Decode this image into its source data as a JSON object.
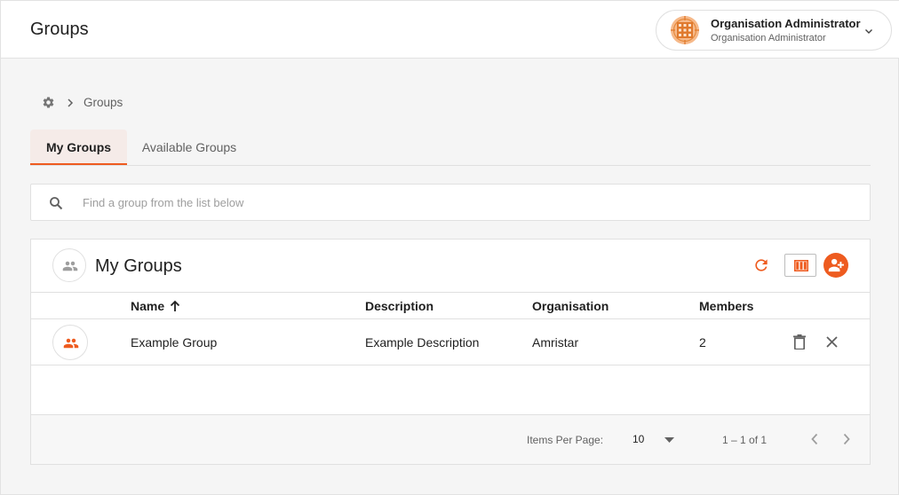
{
  "header": {
    "title": "Groups",
    "user": {
      "name": "Organisation Administrator",
      "role": "Organisation Administrator"
    }
  },
  "breadcrumb": {
    "current": "Groups"
  },
  "tabs": [
    {
      "label": "My Groups",
      "active": true
    },
    {
      "label": "Available Groups",
      "active": false
    }
  ],
  "search": {
    "value": "",
    "placeholder": "Find a group from the list below"
  },
  "card": {
    "title": "My Groups",
    "columns": [
      "Name",
      "Description",
      "Organisation",
      "Members"
    ],
    "sort": {
      "column": "Name",
      "direction": "ascending"
    },
    "rows": [
      {
        "name": "Example Group",
        "description": "Example Description",
        "organisation": "Amristar",
        "members": "2"
      }
    ]
  },
  "paginator": {
    "items_per_page_label": "Items Per Page:",
    "items_per_page": "10",
    "range": "1 – 1 of 1"
  },
  "colors": {
    "accent": "#ee5b1f",
    "tab_active_bg": "#f5ebe8"
  }
}
